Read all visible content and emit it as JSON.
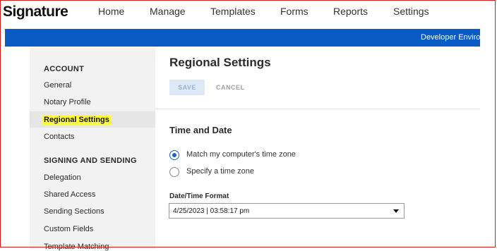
{
  "app": {
    "logo_text": "Signature"
  },
  "topnav": {
    "items": [
      {
        "label": "Home"
      },
      {
        "label": "Manage"
      },
      {
        "label": "Templates"
      },
      {
        "label": "Forms"
      },
      {
        "label": "Reports"
      },
      {
        "label": "Settings"
      }
    ]
  },
  "banner": {
    "text": "Developer Environ"
  },
  "sidebar": {
    "account_heading": "ACCOUNT",
    "account_items": [
      "General",
      "Notary Profile",
      "Regional Settings",
      "Contacts"
    ],
    "active_item": "Regional Settings",
    "highlight_color": "#fffb3d",
    "signing_heading": "SIGNING AND SENDING",
    "signing_items": [
      "Delegation",
      "Shared Access",
      "Sending Sections",
      "Custom Fields",
      "Template Matching"
    ]
  },
  "main": {
    "title": "Regional Settings",
    "save_label": "SAVE",
    "cancel_label": "CANCEL",
    "section_title": "Time and Date",
    "timezone_options": [
      {
        "label": "Match my computer's time zone",
        "checked": true
      },
      {
        "label": "Specify a time zone",
        "checked": false
      }
    ],
    "datetime_format_label": "Date/Time Format",
    "datetime_format_value": "4/25/2023 | 03:58:17 pm"
  },
  "colors": {
    "accent": "#0a5bc4",
    "radio_selected": "#1a63c8"
  }
}
